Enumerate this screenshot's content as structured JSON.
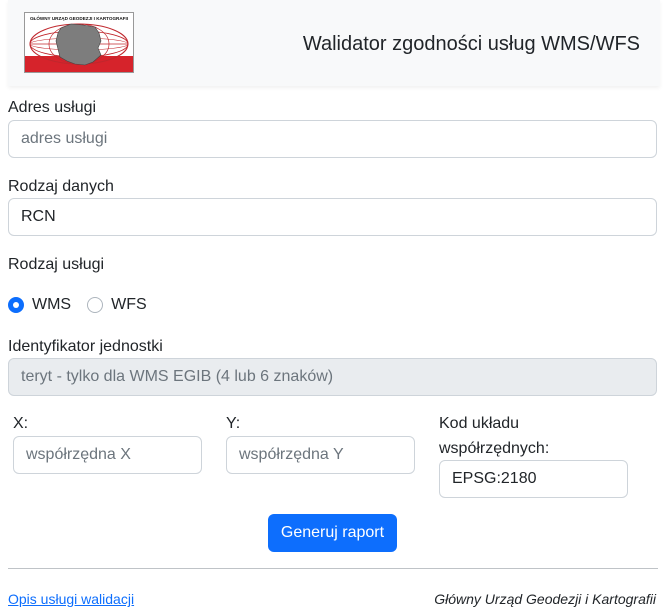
{
  "header": {
    "logo_text": "GŁÓWNY URZĄD GEODEZJI I KARTOGRAFII",
    "title": "Walidator zgodności usług WMS/WFS",
    "colors": {
      "logo_red": "#d6232b",
      "map_gray": "#7d7d7d"
    }
  },
  "form": {
    "service_address": {
      "label": "Adres usługi",
      "placeholder": "adres usługi",
      "value": ""
    },
    "data_type": {
      "label": "Rodzaj danych",
      "value": "RCN"
    },
    "service_type": {
      "label": "Rodzaj usługi",
      "options": [
        {
          "label": "WMS",
          "checked": true
        },
        {
          "label": "WFS",
          "checked": false
        }
      ]
    },
    "unit_id": {
      "label": "Identyfikator jednostki",
      "placeholder": "teryt - tylko dla WMS EGIB (4 lub 6 znaków)",
      "disabled": true
    },
    "x": {
      "label": "X:",
      "placeholder": "współrzędna X"
    },
    "y": {
      "label": "Y:",
      "placeholder": "współrzędna Y"
    },
    "crs": {
      "label_line1": "Kod układu",
      "label_line2": "współrzędnych:",
      "value": "EPSG:2180"
    },
    "submit_label": "Generuj raport"
  },
  "footer": {
    "link_label": "Opis usługi walidacji",
    "organization": "Główny Urząd Geodezji i Kartografii"
  },
  "colors": {
    "primary": "#0d6efd",
    "border": "#ced4da",
    "disabled_bg": "#e9ecef",
    "header_bg": "#f8f9fa"
  }
}
